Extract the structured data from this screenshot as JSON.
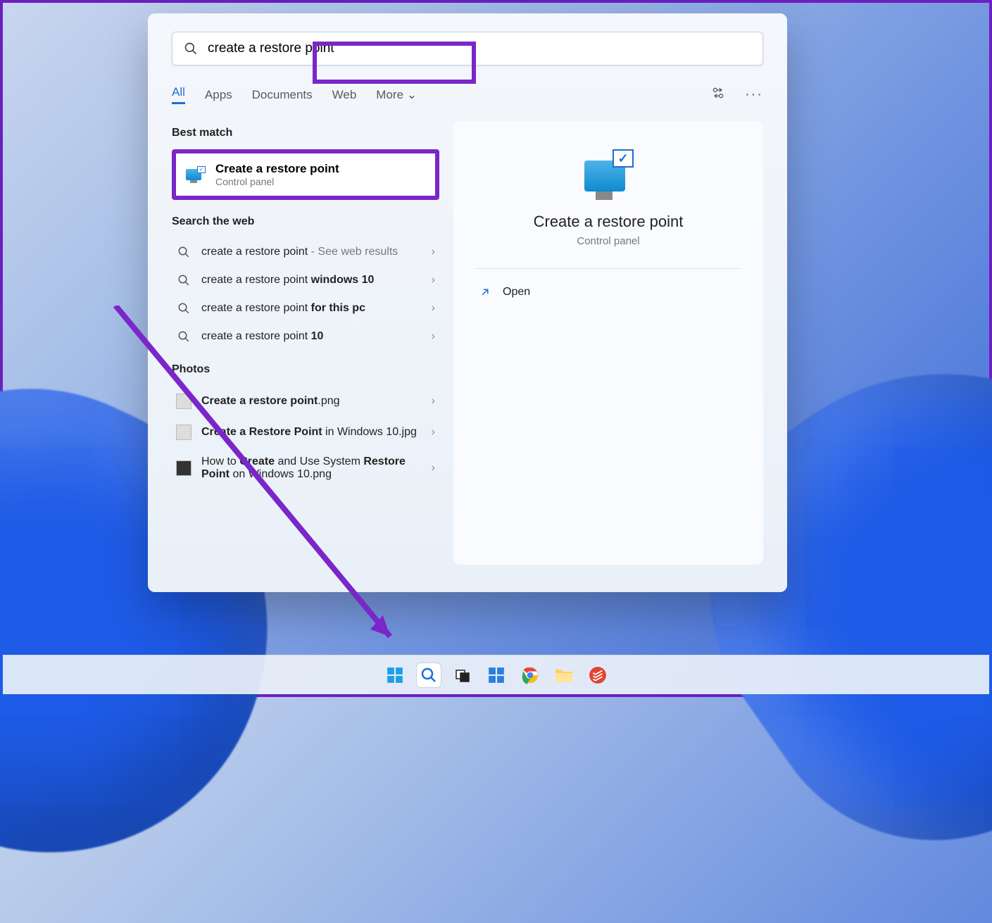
{
  "search": {
    "query": "create a restore point"
  },
  "filter_tabs": {
    "all": "All",
    "apps": "Apps",
    "documents": "Documents",
    "web": "Web",
    "more": "More"
  },
  "sections": {
    "best_match": "Best match",
    "search_web": "Search the web",
    "photos": "Photos"
  },
  "best_match_result": {
    "title": "Create a restore point",
    "subtitle": "Control panel"
  },
  "web_results": [
    {
      "prefix": "create a restore point",
      "suffix": "",
      "hint": " - See web results"
    },
    {
      "prefix": "create a restore point ",
      "suffix": "windows 10",
      "hint": ""
    },
    {
      "prefix": "create a restore point ",
      "suffix": "for this pc",
      "hint": ""
    },
    {
      "prefix": "create a restore point ",
      "suffix": "10",
      "hint": ""
    }
  ],
  "photo_results": [
    {
      "pre": "",
      "bold": "Create a restore point",
      "post": ".png"
    },
    {
      "pre": "",
      "bold": "Create a Restore Point",
      "post": " in Windows 10.jpg"
    },
    {
      "pre": "How to ",
      "bold": "Create",
      "post": " and Use System ",
      "bold2": "Restore Point",
      "post2": " on Windows 10.png"
    }
  ],
  "preview": {
    "title": "Create a restore point",
    "subtitle": "Control panel",
    "open": "Open"
  }
}
